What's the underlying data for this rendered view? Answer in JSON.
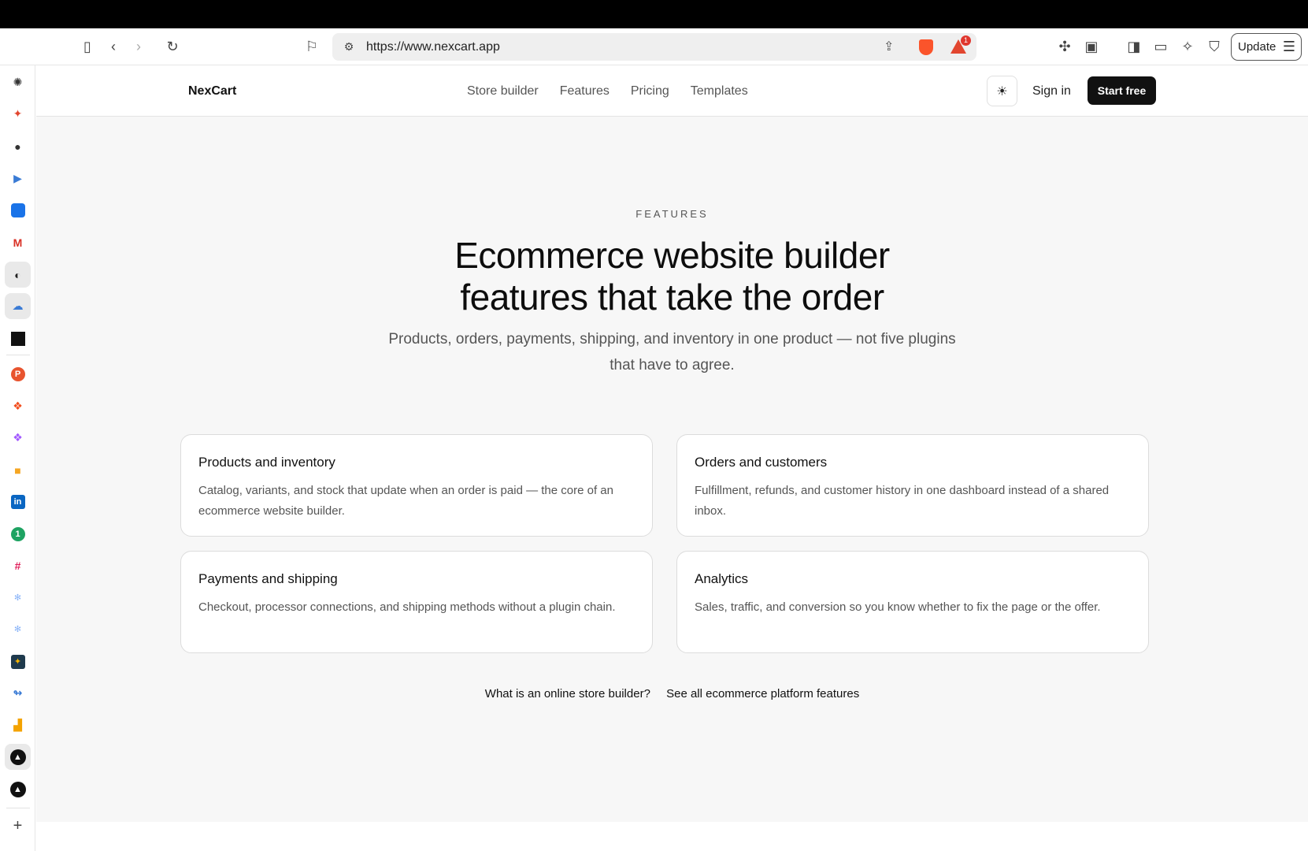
{
  "browser": {
    "url": "https://www.nexcart.app",
    "update_label": "Update",
    "rewards_badge": "1",
    "sidebar_icons": [
      "chatgpt-icon",
      "spark-icon",
      "apple-icon",
      "play-icon",
      "tool-icon",
      "gmail-icon",
      "github-icon",
      "cloud-icon",
      "screen-icon",
      "producthunt-icon",
      "figma-icon",
      "figma-alt-icon",
      "video-icon",
      "linkedin-icon",
      "whatsapp-icon",
      "slack-icon",
      "snowflake-icon",
      "snowflake-alt-icon",
      "sparkle-app-icon",
      "sync-icon",
      "analytics-icon",
      "vercel-icon",
      "vercel-alt-icon",
      "add-icon"
    ]
  },
  "nav": {
    "brand": "NexCart",
    "links": [
      "Store builder",
      "Features",
      "Pricing",
      "Templates"
    ],
    "sign_in": "Sign in",
    "start_free": "Start free"
  },
  "hero": {
    "eyebrow": "FEATURES",
    "title_line1": "Ecommerce website builder",
    "title_line2": "features that take the order",
    "subtitle": "Products, orders, payments, shipping, and inventory in one product — not five plugins that have to agree."
  },
  "cards": [
    {
      "title": "Products and inventory",
      "text": "Catalog, variants, and stock that update when an order is paid — the core of an ecommerce website builder."
    },
    {
      "title": "Orders and customers",
      "text": "Fulfillment, refunds, and customer history in one dashboard instead of a shared inbox."
    },
    {
      "title": "Payments and shipping",
      "text": "Checkout, processor connections, and shipping methods without a plugin chain."
    },
    {
      "title": "Analytics",
      "text": "Sales, traffic, and conversion so you know whether to fix the page or the offer."
    }
  ],
  "footer_links": [
    "What is an online store builder?",
    "See all ecommerce platform features"
  ]
}
